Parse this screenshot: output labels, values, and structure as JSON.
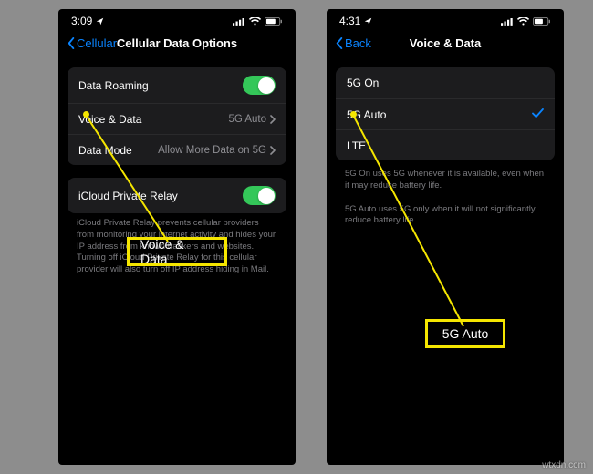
{
  "watermark": "wtxdn.com",
  "left": {
    "status": {
      "time": "3:09",
      "location_icon": "location",
      "signal": 4,
      "wifi": 3,
      "battery": 70
    },
    "nav": {
      "back": "Cellular",
      "title": "Cellular Data Options"
    },
    "section1": {
      "roaming_label": "Data Roaming",
      "voice_label": "Voice & Data",
      "voice_value": "5G Auto",
      "mode_label": "Data Mode",
      "mode_value": "Allow More Data on 5G"
    },
    "section2": {
      "relay_label": "iCloud Private Relay",
      "relay_footer": "iCloud Private Relay prevents cellular providers from monitoring your internet activity and hides your IP address from known trackers and websites. Turning off iCloud Private Relay for this cellular provider will also turn off IP address hiding in Mail."
    },
    "callout": "Voice & Data"
  },
  "right": {
    "status": {
      "time": "4:31",
      "location_icon": "location",
      "signal": 4,
      "wifi": 3,
      "battery": 65
    },
    "nav": {
      "back": "Back",
      "title": "Voice & Data"
    },
    "options": {
      "opt1": "5G On",
      "opt2": "5G Auto",
      "opt3": "LTE"
    },
    "footer1": "5G On uses 5G whenever it is available, even when it may reduce battery life.",
    "footer2": "5G Auto uses 5G only when it will not significantly reduce battery life.",
    "callout": "5G Auto"
  }
}
